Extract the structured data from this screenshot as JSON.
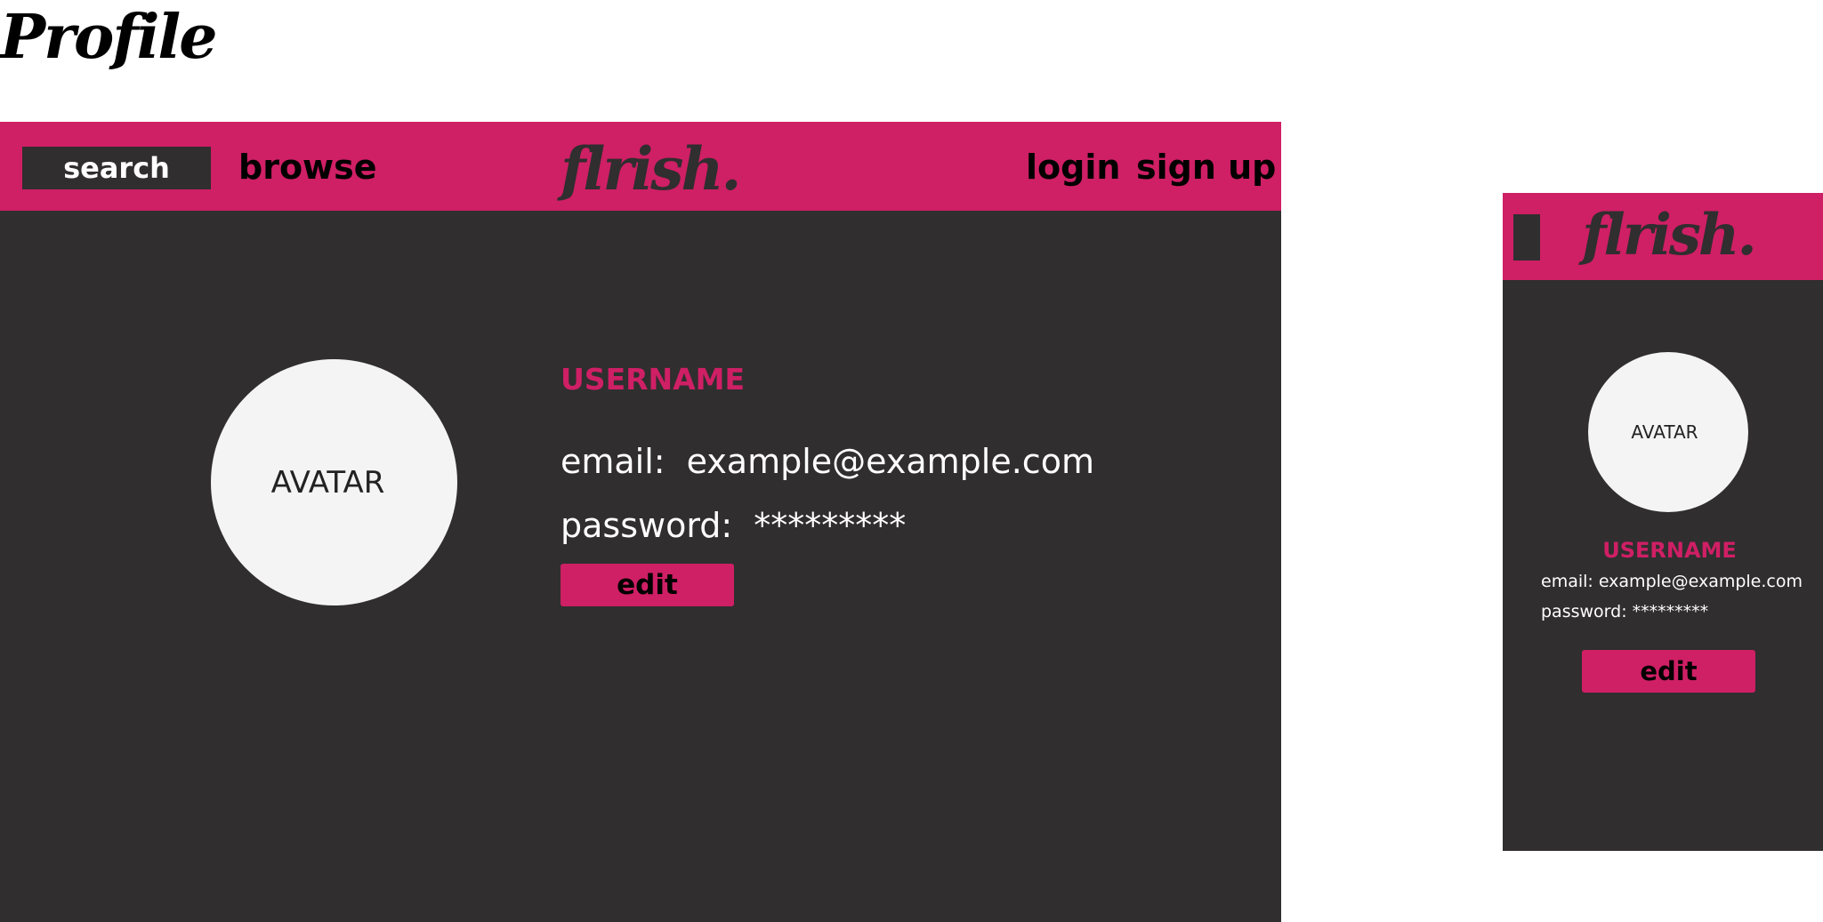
{
  "page_title": "Profile",
  "brand": {
    "logo": "flrish.",
    "accent_color": "#cf1f65",
    "dark_color": "#302e2f"
  },
  "desktop": {
    "nav": {
      "search_label": "search",
      "browse_label": "browse",
      "login_label": "login",
      "signup_label": "sign up"
    },
    "profile": {
      "avatar_label": "AVATAR",
      "username": "USERNAME",
      "email_label": "email:",
      "email_value": "example@example.com",
      "password_label": "password:",
      "password_value": "*********",
      "edit_label": "edit"
    }
  },
  "mobile": {
    "menu_icon": "menu-block-icon",
    "profile": {
      "avatar_label": "AVATAR",
      "username": "USERNAME",
      "email_label": "email:",
      "email_value": "example@example.com",
      "password_label": "password:",
      "password_value": "*********",
      "edit_label": "edit"
    }
  }
}
